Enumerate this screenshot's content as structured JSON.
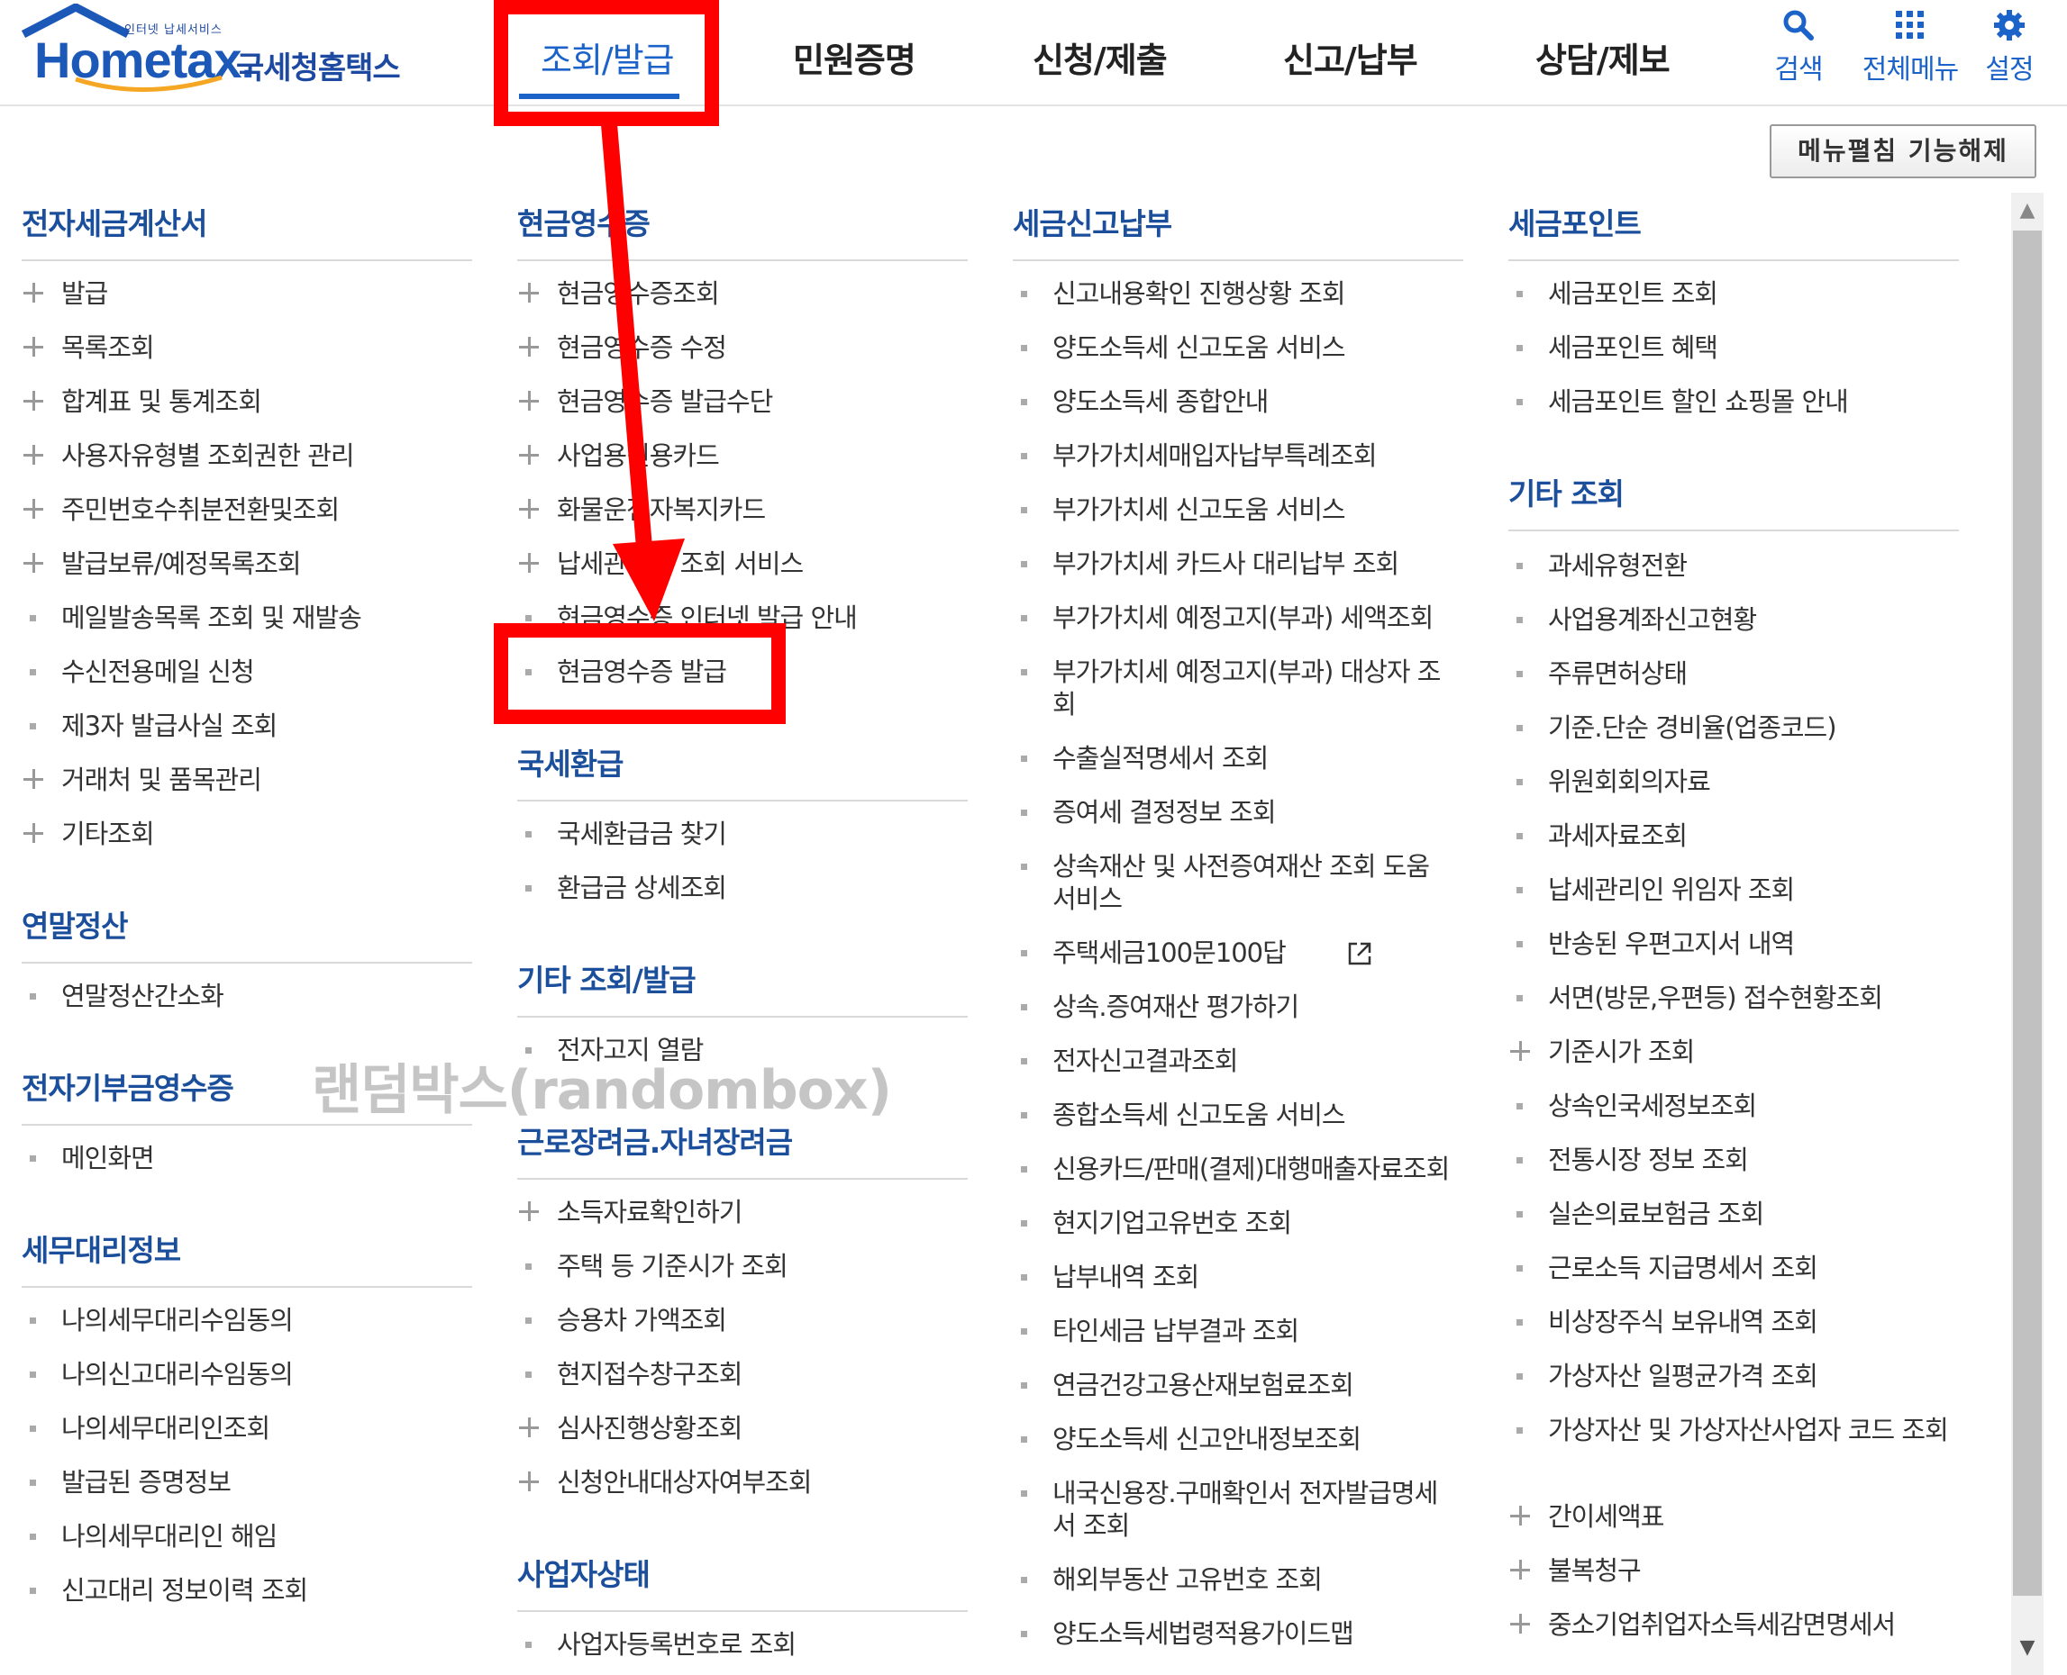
{
  "header": {
    "logo_small_text": "인터넷 납세서비스",
    "logo_word": "Hometax.",
    "logo_kor": "국세청홈택스",
    "nav": [
      "조회/발급",
      "민원증명",
      "신청/제출",
      "신고/납부",
      "상담/제보"
    ],
    "utils": [
      {
        "label": "검색",
        "icon": "search-icon"
      },
      {
        "label": "전체메뉴",
        "icon": "grid-icon"
      },
      {
        "label": "설정",
        "icon": "gear-icon"
      }
    ]
  },
  "collapse_button": "메뉴펼침 기능해제",
  "watermark": "랜덤박스(randombox)",
  "columns": [
    {
      "sections": [
        {
          "title": "전자세금계산서",
          "items": [
            {
              "marker": "plus",
              "text": "발급"
            },
            {
              "marker": "plus",
              "text": "목록조회"
            },
            {
              "marker": "plus",
              "text": "합계표 및 통계조회"
            },
            {
              "marker": "plus",
              "text": "사용자유형별 조회권한 관리"
            },
            {
              "marker": "plus",
              "text": "주민번호수취분전환및조회"
            },
            {
              "marker": "plus",
              "text": "발급보류/예정목록조회"
            },
            {
              "marker": "dot",
              "text": "메일발송목록 조회 및 재발송"
            },
            {
              "marker": "dot",
              "text": "수신전용메일 신청"
            },
            {
              "marker": "dot",
              "text": "제3자 발급사실 조회"
            },
            {
              "marker": "plus",
              "text": "거래처 및 품목관리"
            },
            {
              "marker": "plus",
              "text": "기타조회"
            }
          ]
        },
        {
          "title": "연말정산",
          "items": [
            {
              "marker": "dot",
              "text": "연말정산간소화"
            }
          ]
        },
        {
          "title": "전자기부금영수증",
          "items": [
            {
              "marker": "dot",
              "text": "메인화면"
            }
          ]
        },
        {
          "title": "세무대리정보",
          "items": [
            {
              "marker": "dot",
              "text": "나의세무대리수임동의"
            },
            {
              "marker": "dot",
              "text": "나의신고대리수임동의"
            },
            {
              "marker": "dot",
              "text": "나의세무대리인조회"
            },
            {
              "marker": "dot",
              "text": "발급된 증명정보"
            },
            {
              "marker": "dot",
              "text": "나의세무대리인 해임"
            },
            {
              "marker": "dot",
              "text": "신고대리 정보이력 조회"
            }
          ]
        }
      ]
    },
    {
      "sections": [
        {
          "title": "현금영수증",
          "items": [
            {
              "marker": "plus",
              "text": "현금영수증조회"
            },
            {
              "marker": "plus",
              "text": "현금영수증 수정"
            },
            {
              "marker": "plus",
              "text": "현금영수증 발급수단"
            },
            {
              "marker": "plus",
              "text": "사업용신용카드"
            },
            {
              "marker": "plus",
              "text": "화물운전자복지카드"
            },
            {
              "marker": "plus",
              "text": "납세관리인 조회 서비스"
            },
            {
              "marker": "dot",
              "text": "현금영수증 인터넷 발급 안내"
            },
            {
              "marker": "dot",
              "text": "현금영수증 발급"
            }
          ]
        },
        {
          "title": "국세환급",
          "items": [
            {
              "marker": "dot",
              "text": "국세환급금 찾기"
            },
            {
              "marker": "dot",
              "text": "환급금 상세조회"
            }
          ]
        },
        {
          "title": "기타 조회/발급",
          "items": [
            {
              "marker": "dot",
              "text": "전자고지 열람"
            }
          ]
        },
        {
          "title": "근로장려금.자녀장려금",
          "items": [
            {
              "marker": "plus",
              "text": "소득자료확인하기"
            },
            {
              "marker": "dot",
              "text": "주택 등 기준시가 조회"
            },
            {
              "marker": "dot",
              "text": "승용차 가액조회"
            },
            {
              "marker": "dot",
              "text": "현지접수창구조회"
            },
            {
              "marker": "plus",
              "text": "심사진행상황조회"
            },
            {
              "marker": "plus",
              "text": "신청안내대상자여부조회"
            }
          ]
        },
        {
          "title": "사업자상태",
          "items": [
            {
              "marker": "dot",
              "text": "사업자등록번호로 조회"
            }
          ]
        }
      ]
    },
    {
      "sections": [
        {
          "title": "세금신고납부",
          "items": [
            {
              "marker": "dot",
              "text": "신고내용확인 진행상황 조회"
            },
            {
              "marker": "dot",
              "text": "양도소득세 신고도움 서비스"
            },
            {
              "marker": "dot",
              "text": "양도소득세 종합안내"
            },
            {
              "marker": "dot",
              "text": "부가가치세매입자납부특례조회"
            },
            {
              "marker": "dot",
              "text": "부가가치세 신고도움 서비스"
            },
            {
              "marker": "dot",
              "text": "부가가치세 카드사 대리납부 조회"
            },
            {
              "marker": "dot",
              "text": "부가가치세 예정고지(부과) 세액조회"
            },
            {
              "marker": "dot",
              "text": "부가가치세 예정고지(부과) 대상자 조회"
            },
            {
              "marker": "dot",
              "text": "수출실적명세서 조회"
            },
            {
              "marker": "dot",
              "text": "증여세 결정정보 조회"
            },
            {
              "marker": "dot",
              "text": "상속재산 및 사전증여재산 조회 도움 서비스"
            },
            {
              "marker": "dot",
              "text": "주택세금100문100답"
            },
            {
              "marker": "dot",
              "text": "상속.증여재산 평가하기"
            },
            {
              "marker": "dot",
              "text": "전자신고결과조회"
            },
            {
              "marker": "dot",
              "text": "종합소득세 신고도움 서비스"
            },
            {
              "marker": "dot",
              "text": "신용카드/판매(결제)대행매출자료조회"
            },
            {
              "marker": "dot",
              "text": "현지기업고유번호 조회"
            },
            {
              "marker": "dot",
              "text": "납부내역 조회"
            },
            {
              "marker": "dot",
              "text": "타인세금 납부결과 조회"
            },
            {
              "marker": "dot",
              "text": "연금건강고용산재보험료조회"
            },
            {
              "marker": "dot",
              "text": "양도소득세 신고안내정보조회"
            },
            {
              "marker": "dot",
              "text": "내국신용장.구매확인서 전자발급명세서 조회"
            },
            {
              "marker": "dot",
              "text": "해외부동산 고유번호 조회"
            },
            {
              "marker": "dot",
              "text": "양도소득세법령적용가이드맵"
            }
          ]
        }
      ]
    },
    {
      "sections": [
        {
          "title": "세금포인트",
          "items": [
            {
              "marker": "dot",
              "text": "세금포인트 조회"
            },
            {
              "marker": "dot",
              "text": "세금포인트 혜택"
            },
            {
              "marker": "dot",
              "text": "세금포인트 할인 쇼핑몰 안내"
            }
          ]
        },
        {
          "title": "기타 조회",
          "items": [
            {
              "marker": "dot",
              "text": "과세유형전환"
            },
            {
              "marker": "dot",
              "text": "사업용계좌신고현황"
            },
            {
              "marker": "dot",
              "text": "주류면허상태"
            },
            {
              "marker": "dot",
              "text": "기준.단순 경비율(업종코드)"
            },
            {
              "marker": "dot",
              "text": "위원회회의자료"
            },
            {
              "marker": "dot",
              "text": "과세자료조회"
            },
            {
              "marker": "dot",
              "text": "납세관리인 위임자 조회"
            },
            {
              "marker": "dot",
              "text": "반송된 우편고지서 내역"
            },
            {
              "marker": "dot",
              "text": "서면(방문,우편등) 접수현황조회"
            },
            {
              "marker": "plus",
              "text": "기준시가 조회"
            },
            {
              "marker": "dot",
              "text": "상속인국세정보조회"
            },
            {
              "marker": "dot",
              "text": "전통시장 정보 조회"
            },
            {
              "marker": "dot",
              "text": "실손의료보험금 조회"
            },
            {
              "marker": "dot",
              "text": "근로소득 지급명세서 조회"
            },
            {
              "marker": "dot",
              "text": "비상장주식 보유내역 조회"
            },
            {
              "marker": "dot",
              "text": "가상자산 일평균가격 조회"
            },
            {
              "marker": "dot",
              "text": "가상자산 및 가상자산사업자 코드 조회"
            },
            {
              "marker": "plus",
              "text": "간이세액표"
            },
            {
              "marker": "plus",
              "text": "불복청구"
            },
            {
              "marker": "plus",
              "text": "중소기업취업자소득세감면명세서"
            }
          ]
        }
      ]
    }
  ],
  "colors": {
    "brand": "#1b58b8",
    "title": "#1b4f9c",
    "active": "#1b63c9",
    "highlight": "#ff0000"
  }
}
